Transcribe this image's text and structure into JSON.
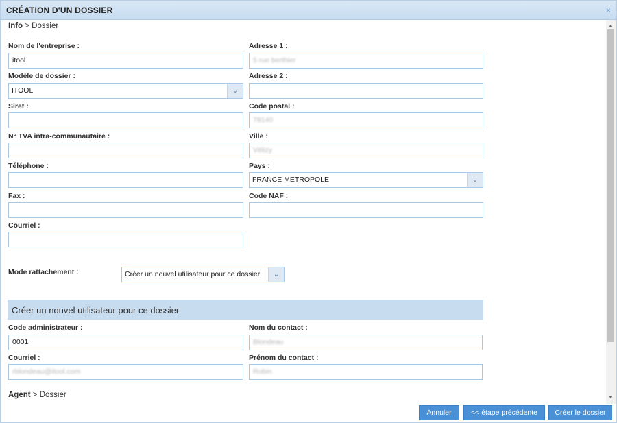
{
  "dialog": {
    "title": "CRÉATION D'UN DOSSIER",
    "close": "×"
  },
  "breadcrumb_top": {
    "strong": "Info",
    "rest": " > Dossier"
  },
  "left": {
    "company_label": "Nom de l'entreprise :",
    "company_value": "itool",
    "model_label": "Modèle de dossier :",
    "model_value": "ITOOL",
    "siret_label": "Siret :",
    "tva_label": "N° TVA intra-communautaire :",
    "phone_label": "Téléphone :",
    "fax_label": "Fax :",
    "email_label": "Courriel :"
  },
  "right": {
    "addr1_label": "Adresse 1 :",
    "addr1_value": "5 rue berthier",
    "addr2_label": "Adresse 2 :",
    "postal_label": "Code postal :",
    "postal_value": "78140",
    "city_label": "Ville :",
    "city_value": "Vélizy",
    "country_label": "Pays :",
    "country_value": "FRANCE METROPOLE",
    "naf_label": "Code NAF :"
  },
  "attach": {
    "label": "Mode rattachement :",
    "value": "Créer un nouvel utilisateur pour ce dossier"
  },
  "new_user": {
    "section_title": "Créer un nouvel utilisateur pour ce dossier",
    "admin_code_label": "Code administrateur :",
    "admin_code_value": "0001",
    "contact_name_label": "Nom du contact :",
    "contact_name_value": "Blondeau",
    "email_label": "Courriel :",
    "email_value": "rblondeau@itool.com",
    "contact_firstname_label": "Prénom du contact :",
    "contact_firstname_value": "Robin"
  },
  "breadcrumb_bottom": {
    "strong": "Agent",
    "rest": " > Dossier"
  },
  "buttons": {
    "cancel": "Annuler",
    "previous": "<< étape précédente",
    "create": "Créer le dossier"
  },
  "icons": {
    "chevron": "chevron-down-icon",
    "scroll_up": "arrow-up-icon",
    "scroll_down": "arrow-down-icon"
  }
}
